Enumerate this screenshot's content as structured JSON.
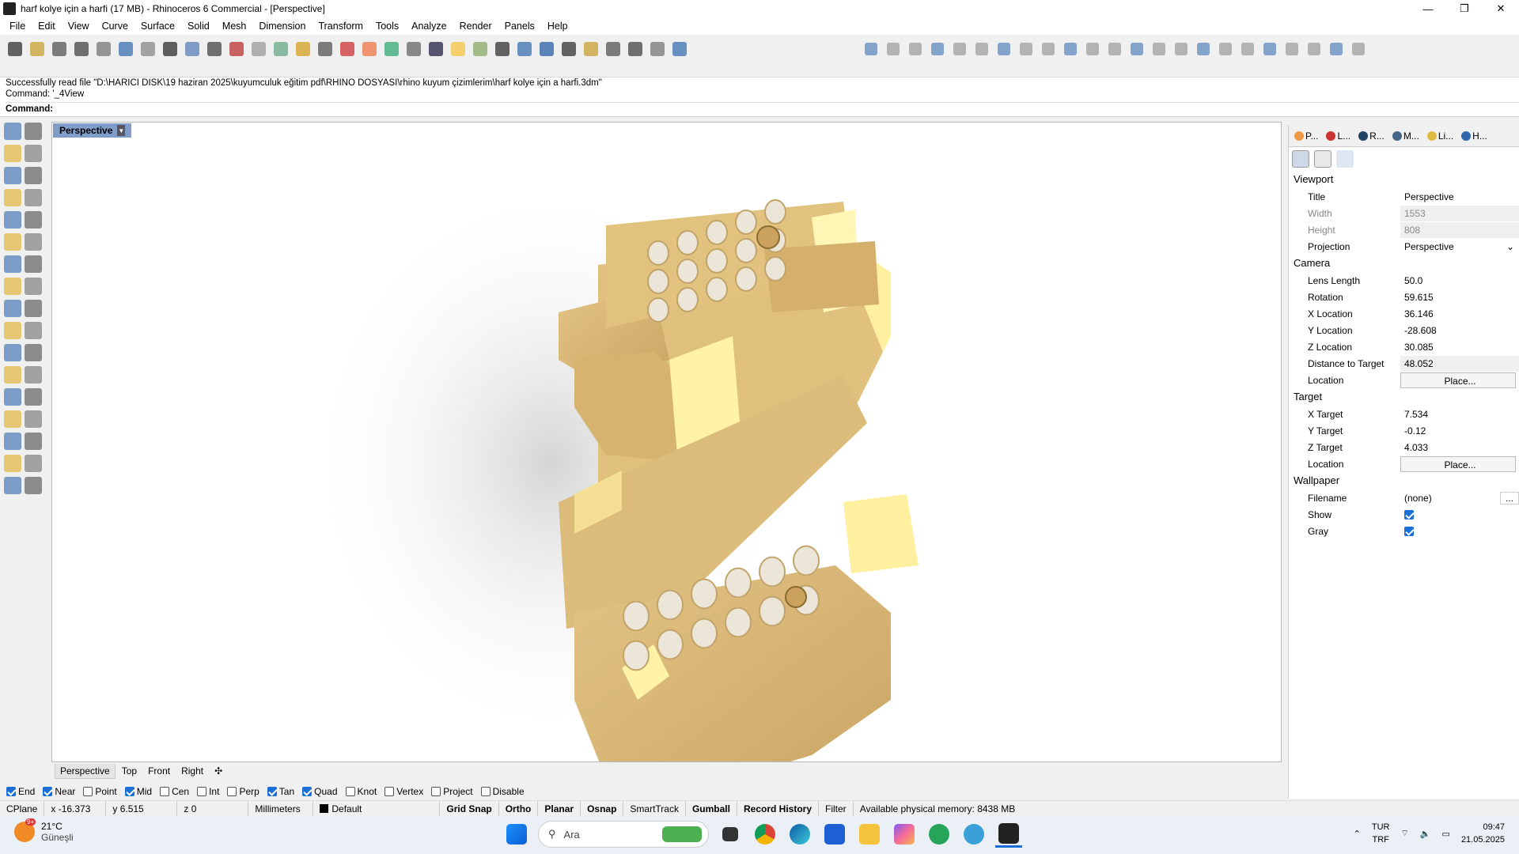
{
  "window": {
    "title": "harf kolye için a harfi (17 MB) - Rhinoceros 6 Commercial - [Perspective]"
  },
  "menu": [
    "File",
    "Edit",
    "View",
    "Curve",
    "Surface",
    "Solid",
    "Mesh",
    "Dimension",
    "Transform",
    "Tools",
    "Analyze",
    "Render",
    "Panels",
    "Help"
  ],
  "command": {
    "line1": "Successfully read file \"D:\\HARICI DISK\\19 haziran 2025\\kuyumculuk eğitim pdf\\RHINO DOSYASI\\rhino kuyum çizimlerim\\harf kolye için a harfi.3dm\"",
    "line2": "Command: '_4View",
    "prompt": "Command:"
  },
  "viewport": {
    "title": "Perspective"
  },
  "view_tabs": [
    "Perspective",
    "Top",
    "Front",
    "Right"
  ],
  "osnap": [
    {
      "label": "End",
      "checked": true
    },
    {
      "label": "Near",
      "checked": true
    },
    {
      "label": "Point",
      "checked": false
    },
    {
      "label": "Mid",
      "checked": true
    },
    {
      "label": "Cen",
      "checked": false
    },
    {
      "label": "Int",
      "checked": false
    },
    {
      "label": "Perp",
      "checked": false
    },
    {
      "label": "Tan",
      "checked": true
    },
    {
      "label": "Quad",
      "checked": true
    },
    {
      "label": "Knot",
      "checked": false
    },
    {
      "label": "Vertex",
      "checked": false
    },
    {
      "label": "Project",
      "checked": false
    },
    {
      "label": "Disable",
      "checked": false
    }
  ],
  "status": {
    "cplane": "CPlane",
    "x": "x -16.373",
    "y": "y 6.515",
    "z": "z 0",
    "units": "Millimeters",
    "layer": "Default",
    "grid_snap": "Grid Snap",
    "ortho": "Ortho",
    "planar": "Planar",
    "osnap": "Osnap",
    "smarttrack": "SmartTrack",
    "gumball": "Gumball",
    "record_history": "Record History",
    "filter": "Filter",
    "memory": "Available physical memory: 8438 MB"
  },
  "panel": {
    "tabs": [
      "P...",
      "L...",
      "R...",
      "M...",
      "Li...",
      "H..."
    ],
    "viewport_header": "Viewport",
    "title_k": "Title",
    "title_v": "Perspective",
    "width_k": "Width",
    "width_v": "1553",
    "height_k": "Height",
    "height_v": "808",
    "projection_k": "Projection",
    "projection_v": "Perspective",
    "camera_header": "Camera",
    "lens_k": "Lens Length",
    "lens_v": "50.0",
    "rotation_k": "Rotation",
    "rotation_v": "59.615",
    "xloc_k": "X Location",
    "xloc_v": "36.146",
    "yloc_k": "Y Location",
    "yloc_v": "-28.608",
    "zloc_k": "Z Location",
    "zloc_v": "30.085",
    "dist_k": "Distance to Target",
    "dist_v": "48.052",
    "loc_k": "Location",
    "place": "Place...",
    "target_header": "Target",
    "xt_k": "X Target",
    "xt_v": "7.534",
    "yt_k": "Y Target",
    "yt_v": "-0.12",
    "zt_k": "Z Target",
    "zt_v": "4.033",
    "wallpaper_header": "Wallpaper",
    "file_k": "Filename",
    "file_v": "(none)",
    "show_k": "Show",
    "gray_k": "Gray",
    "more": "..."
  },
  "taskbar": {
    "temp": "21°C",
    "weather": "Güneşli",
    "badge": "9+",
    "search": "Ara",
    "lang1": "TUR",
    "lang2": "TRF",
    "time": "09:47",
    "date": "21.05.2025"
  },
  "colors": {
    "gold": "#d8b673",
    "gold_light": "#fff3a8",
    "gem": "#ece6d9",
    "accent": "#1a6fd6"
  }
}
